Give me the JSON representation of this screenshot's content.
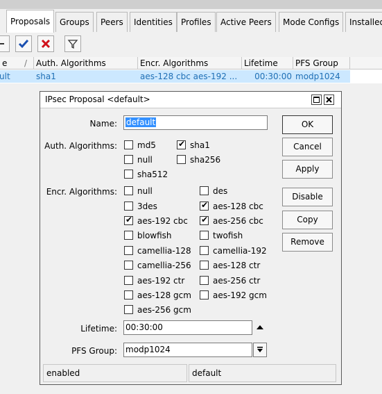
{
  "tabs": [
    "Proposals",
    "Groups",
    "Peers",
    "Identities",
    "Profiles",
    "Active Peers",
    "Mode Configs",
    "Installed"
  ],
  "table": {
    "headers": [
      "e",
      "Auth. Algorithms",
      "Encr. Algorithms",
      "Lifetime",
      "PFS Group"
    ],
    "row": [
      "ult",
      "sha1",
      "aes-128 cbc aes-192 ...",
      "00:30:00",
      "modp1024"
    ]
  },
  "dialog": {
    "title": "IPsec Proposal <default>",
    "name_label": "Name:",
    "name_value": "default",
    "auth_label": "Auth. Algorithms:",
    "auth": [
      {
        "label": "md5",
        "checked": false
      },
      {
        "label": "sha1",
        "checked": true
      },
      {
        "label": "null",
        "checked": false
      },
      {
        "label": "sha256",
        "checked": false
      },
      {
        "label": "sha512",
        "checked": false
      }
    ],
    "encr_label": "Encr. Algorithms:",
    "encr": [
      {
        "label": "null",
        "checked": false
      },
      {
        "label": "des",
        "checked": false
      },
      {
        "label": "3des",
        "checked": false
      },
      {
        "label": "aes-128 cbc",
        "checked": true
      },
      {
        "label": "aes-192 cbc",
        "checked": true
      },
      {
        "label": "aes-256 cbc",
        "checked": true
      },
      {
        "label": "blowfish",
        "checked": false
      },
      {
        "label": "twofish",
        "checked": false
      },
      {
        "label": "camellia-128",
        "checked": false
      },
      {
        "label": "camellia-192",
        "checked": false
      },
      {
        "label": "camellia-256",
        "checked": false
      },
      {
        "label": "aes-128 ctr",
        "checked": false
      },
      {
        "label": "aes-192 ctr",
        "checked": false
      },
      {
        "label": "aes-256 ctr",
        "checked": false
      },
      {
        "label": "aes-128 gcm",
        "checked": false
      },
      {
        "label": "aes-192 gcm",
        "checked": false
      },
      {
        "label": "aes-256 gcm",
        "checked": false
      }
    ],
    "lifetime_label": "Lifetime:",
    "lifetime_value": "00:30:00",
    "pfs_label": "PFS Group:",
    "pfs_value": "modp1024",
    "buttons": {
      "ok": "OK",
      "cancel": "Cancel",
      "apply": "Apply",
      "disable": "Disable",
      "copy": "Copy",
      "remove": "Remove"
    },
    "status_left": "enabled",
    "status_right": "default"
  },
  "colors": {
    "selection": "#cce8ff",
    "link_text": "#1f6fb5",
    "check_blue": "#1a4fb0",
    "x_red": "#d0101a"
  }
}
